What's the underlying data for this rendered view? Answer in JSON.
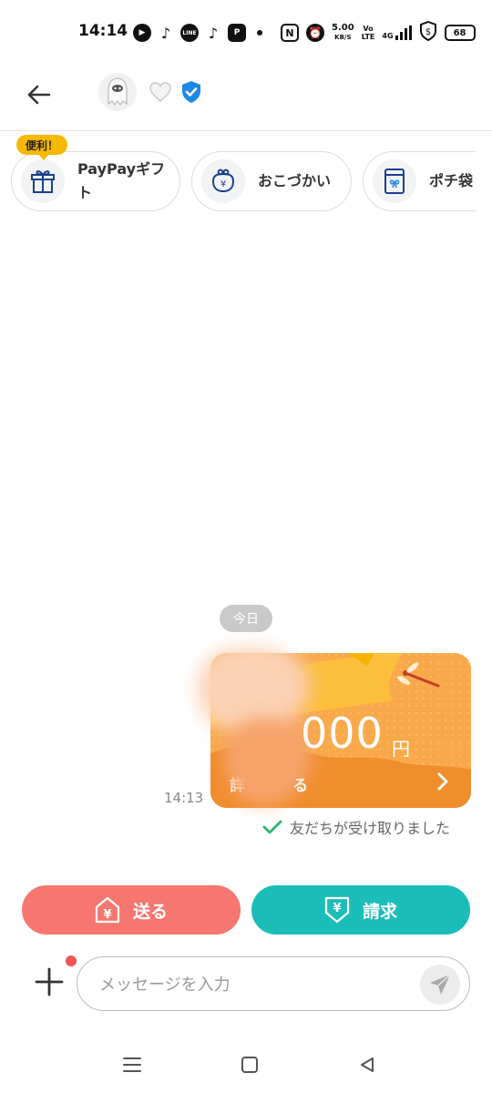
{
  "status_bar": {
    "time": "14:14",
    "speed_value": "5.00",
    "speed_unit": "KB/S",
    "net_top": "Vo",
    "net_bottom": "LTE",
    "net_type": "4G",
    "battery": "68"
  },
  "header": {
    "back_icon": "back-arrow-icon",
    "avatar_icon": "ghost-avatar",
    "heart_icon": "heart-icon",
    "verified_icon": "verified-badge-icon"
  },
  "chips": {
    "badge": "便利！",
    "items": [
      {
        "label": "PayPayギフト",
        "icon": "gift-icon"
      },
      {
        "label": "おこづかい",
        "icon": "coin-purse-icon"
      },
      {
        "label": "ポチ袋",
        "icon": "envelope-icon"
      }
    ]
  },
  "chat": {
    "date_label": "今日",
    "message_time": "14:13",
    "card": {
      "amount": "000",
      "currency": "円",
      "footer_visible": "詳",
      "footer_end": "る"
    },
    "receipt_status": "友だちが受け取りました"
  },
  "actions": {
    "send_label": "送る",
    "request_label": "請求"
  },
  "input": {
    "placeholder": "メッセージを入力"
  },
  "colors": {
    "send": "#f6776f",
    "request": "#1bbdb8",
    "badge": "#f5b800",
    "card": "#f9a94a",
    "verified": "#1e88e5"
  }
}
